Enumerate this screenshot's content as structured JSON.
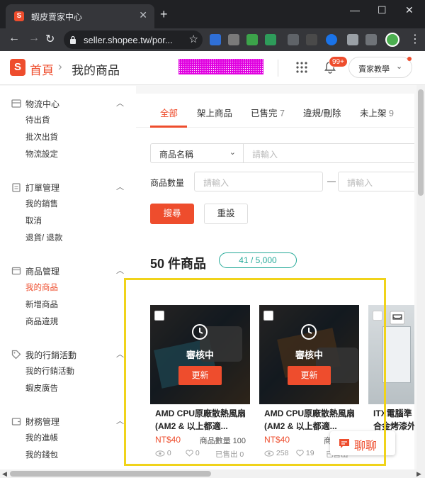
{
  "browser": {
    "tab_title": "蝦皮賣家中心",
    "url": "seller.shopee.tw/por...",
    "favicon_letter": "S"
  },
  "header": {
    "logo_letter": "S",
    "breadcrumb_home": "首頁",
    "breadcrumb_separator": "›",
    "breadcrumb_current": "我的商品",
    "notification_badge": "99+",
    "education_button": "賣家教學",
    "accent_color": "#ee4d2d"
  },
  "sidebar": {
    "sections": [
      {
        "title": "物流中心",
        "items": [
          "待出貨",
          "批次出貨",
          "物流設定"
        ]
      },
      {
        "title": "訂單管理",
        "items": [
          "我的銷售",
          "取消",
          "退貨/ 退款"
        ]
      },
      {
        "title": "商品管理",
        "items": [
          "我的商品",
          "新增商品",
          "商品違規"
        ],
        "active_item": "我的商品"
      },
      {
        "title": "我的行銷活動",
        "items": [
          "我的行銷活動",
          "蝦皮廣告"
        ]
      },
      {
        "title": "財務管理",
        "items": [
          "我的進帳",
          "我的錢包"
        ]
      }
    ]
  },
  "main": {
    "tabs": [
      {
        "label": "全部",
        "count": ""
      },
      {
        "label": "架上商品",
        "count": ""
      },
      {
        "label": "已售完",
        "count": "7"
      },
      {
        "label": "違規/刪除",
        "count": ""
      },
      {
        "label": "未上架",
        "count": "9"
      }
    ],
    "filter": {
      "field_select": "商品名稱",
      "keyword_placeholder": "請輸入",
      "quantity_label": "商品數量",
      "qty_min_placeholder": "請輸入",
      "range_dash": "—",
      "qty_max_placeholder": "請輸入",
      "search_button": "搜尋",
      "reset_button": "重設"
    },
    "product_count": "50 件商品",
    "quota": "41 / 5,000",
    "products": [
      {
        "status": "審核中",
        "update_button": "更新",
        "name": "AMD CPU原廠散熱風扇 (AM2 & 以上都適...",
        "price": "NT$40",
        "stock": "商品數量 100",
        "views": "0",
        "likes": "0",
        "sold": "已售出 0"
      },
      {
        "status": "審核中",
        "update_button": "更新",
        "name": "AMD CPU原廠散熱風扇 (AM2 & 以上都適...",
        "price": "NT$40",
        "stock": "商品數量",
        "views": "258",
        "likes": "19",
        "sold": "已售出"
      },
      {
        "name_line1": "ITX電腦準",
        "name_line2": "合金烤漆外"
      }
    ]
  },
  "chat": {
    "label": "聊聊"
  }
}
